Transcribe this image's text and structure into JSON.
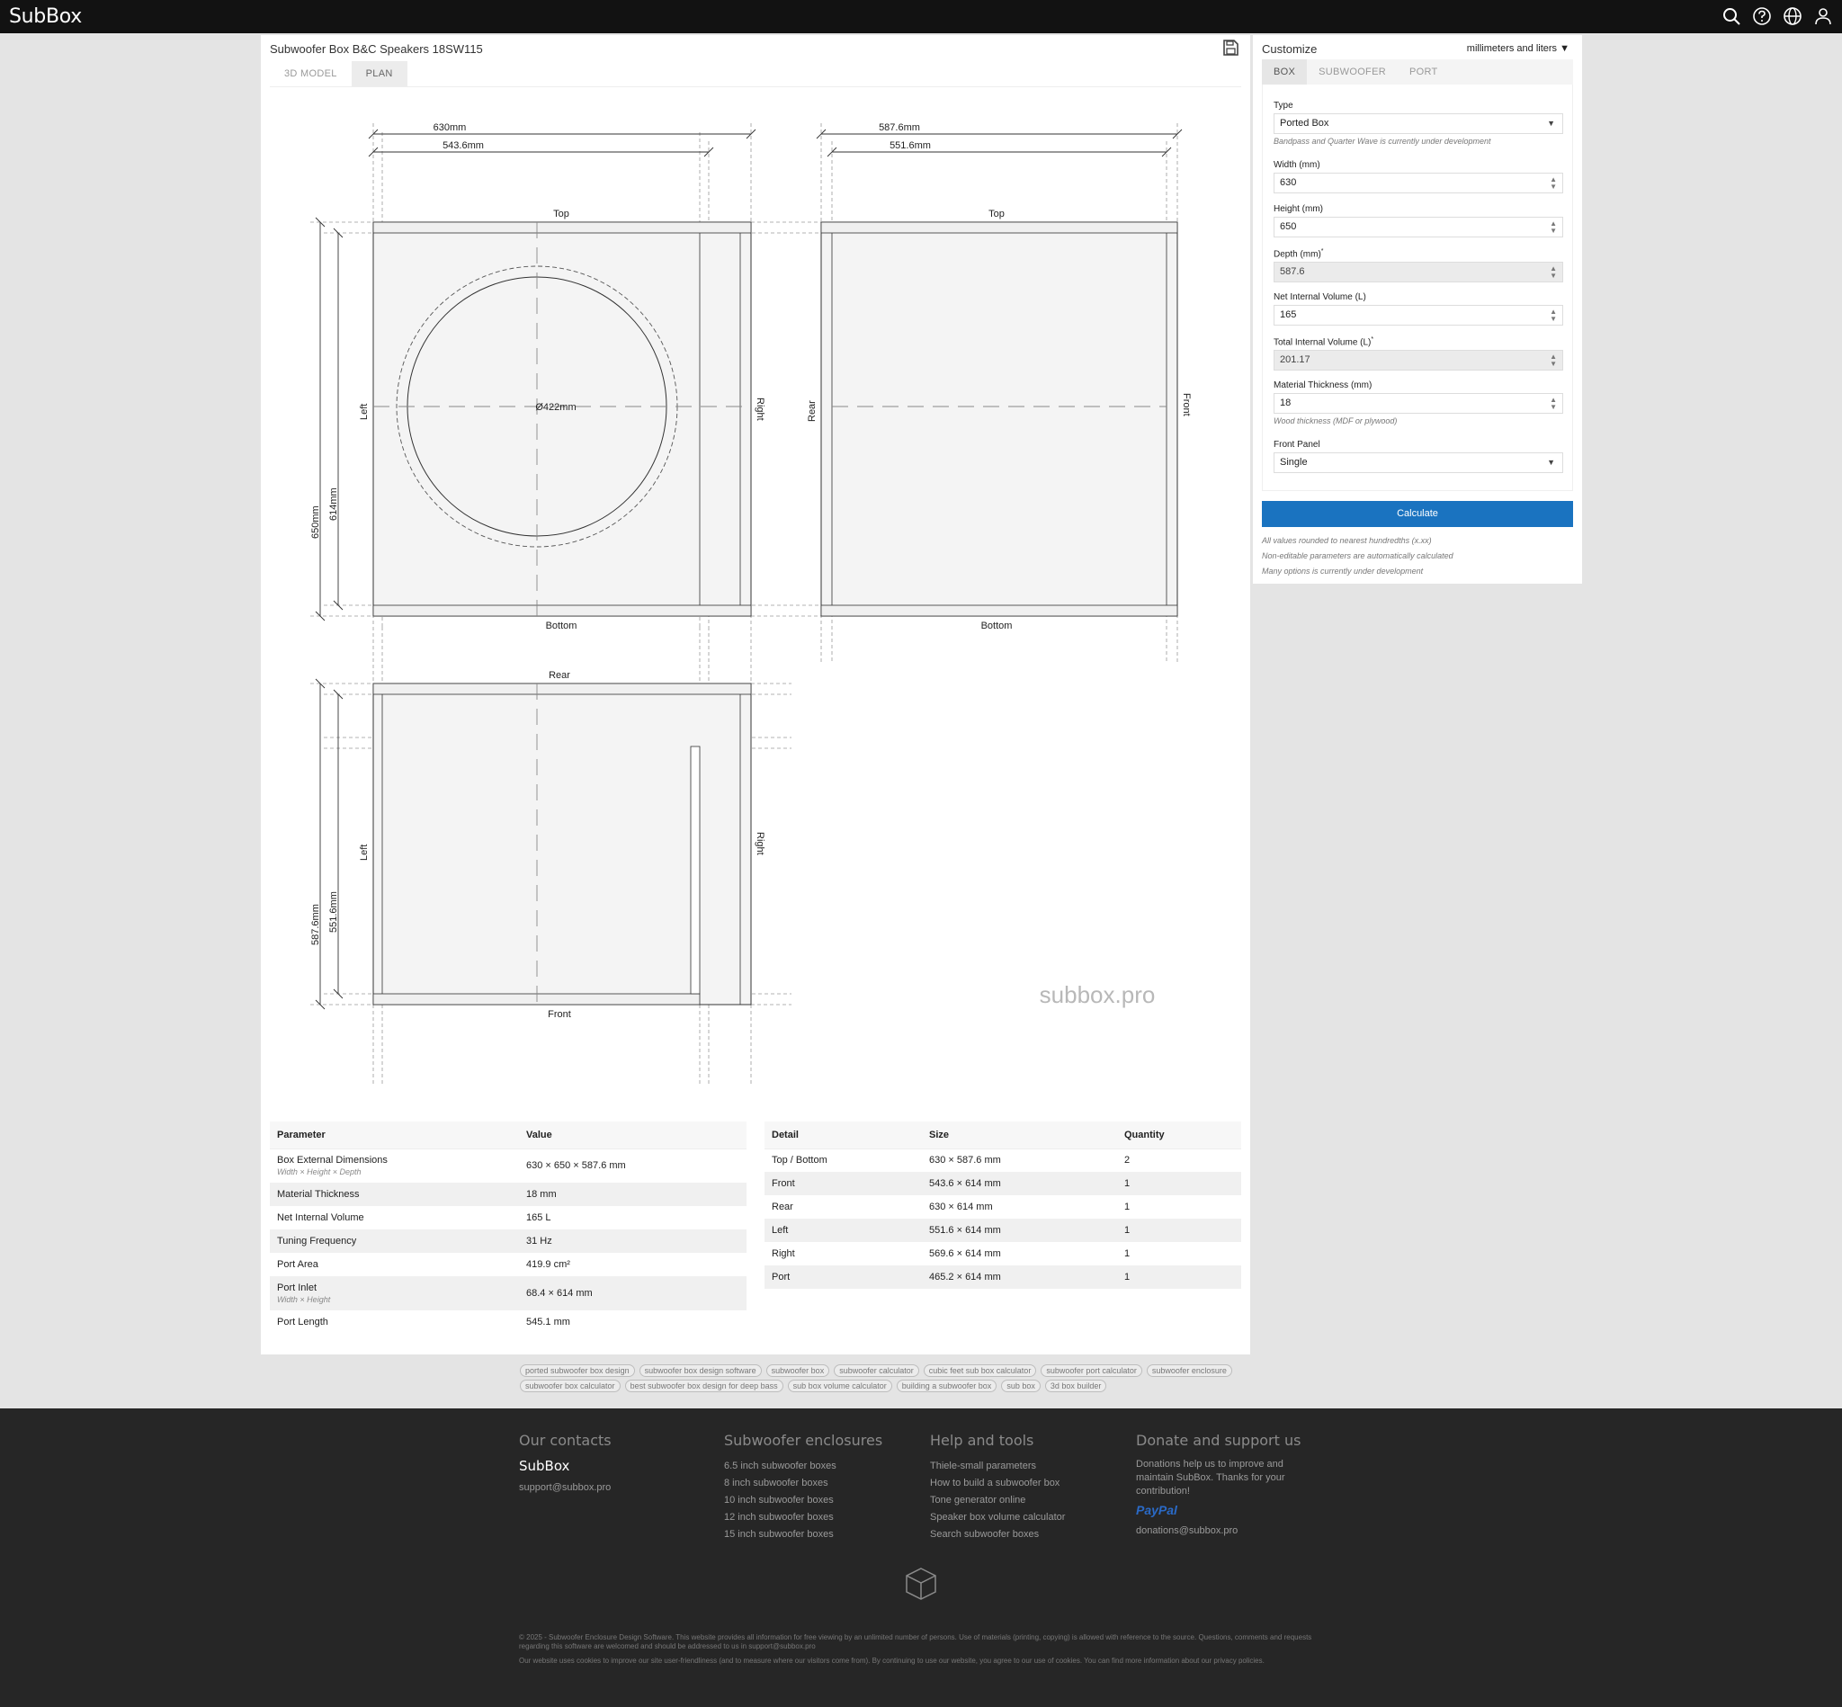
{
  "app": {
    "logo": "SubBox"
  },
  "topbar_icons": [
    "search-icon",
    "help-icon",
    "globe-icon",
    "user-icon"
  ],
  "main": {
    "title": "Subwoofer Box B&C Speakers 18SW115",
    "tabs": [
      {
        "label": "3D MODEL"
      },
      {
        "label": "PLAN"
      }
    ],
    "active_tab": "PLAN"
  },
  "plan": {
    "front_view": {
      "width_dim": "630mm",
      "inner_width_dim": "543.6mm",
      "height_dim": "650mm",
      "inner_height_dim": "614mm",
      "label_top": "Top",
      "label_bottom": "Bottom",
      "label_left": "Left",
      "label_right": "Right",
      "cutout_dim": "Ø422mm"
    },
    "side_view": {
      "depth_dim": "587.6mm",
      "inner_depth_dim": "551.6mm",
      "label_top": "Top",
      "label_bottom": "Bottom",
      "label_rear": "Rear",
      "label_front": "Front"
    },
    "top_view": {
      "depth_dim": "587.6mm",
      "inner_depth_dim": "551.6mm",
      "label_rear": "Rear",
      "label_front": "Front",
      "label_left": "Left",
      "label_right": "Right"
    },
    "watermark": "subbox.pro"
  },
  "param_table": {
    "headers": [
      "Parameter",
      "Value"
    ],
    "rows": [
      {
        "name": "Box External Dimensions",
        "sub": "Width × Height × Depth",
        "value": "630 × 650 × 587.6 mm"
      },
      {
        "name": "Material Thickness",
        "sub": "",
        "value": "18 mm"
      },
      {
        "name": "Net Internal Volume",
        "sub": "",
        "value": "165 L"
      },
      {
        "name": "Tuning Frequency",
        "sub": "",
        "value": "31 Hz"
      },
      {
        "name": "Port Area",
        "sub": "",
        "value": "419.9 cm²"
      },
      {
        "name": "Port Inlet",
        "sub": "Width × Height",
        "value": "68.4 × 614 mm"
      },
      {
        "name": "Port Length",
        "sub": "",
        "value": "545.1 mm"
      }
    ]
  },
  "detail_table": {
    "headers": [
      "Detail",
      "Size",
      "Quantity"
    ],
    "rows": [
      {
        "detail": "Top / Bottom",
        "size": "630 × 587.6 mm",
        "qty": "2"
      },
      {
        "detail": "Front",
        "size": "543.6 × 614 mm",
        "qty": "1"
      },
      {
        "detail": "Rear",
        "size": "630 × 614 mm",
        "qty": "1"
      },
      {
        "detail": "Left",
        "size": "551.6 × 614 mm",
        "qty": "1"
      },
      {
        "detail": "Right",
        "size": "569.6 × 614 mm",
        "qty": "1"
      },
      {
        "detail": "Port",
        "size": "465.2 × 614 mm",
        "qty": "1"
      }
    ]
  },
  "customize": {
    "title": "Customize",
    "units": "millimeters and liters",
    "tabs": [
      {
        "label": "BOX"
      },
      {
        "label": "SUBWOOFER"
      },
      {
        "label": "PORT"
      }
    ],
    "type": {
      "label": "Type",
      "value": "Ported Box",
      "hint": "Bandpass and Quarter Wave is currently under development"
    },
    "width": {
      "label": "Width (mm)",
      "value": "630"
    },
    "height": {
      "label": "Height (mm)",
      "value": "650"
    },
    "depth": {
      "label": "Depth (mm)",
      "value": "587.6"
    },
    "net_volume": {
      "label": "Net Internal Volume (L)",
      "value": "165"
    },
    "total_volume": {
      "label": "Total Internal Volume (L)",
      "value": "201.17"
    },
    "thickness": {
      "label": "Material Thickness (mm)",
      "value": "18",
      "hint": "Wood thickness (MDF or plywood)"
    },
    "front_panel": {
      "label": "Front Panel",
      "value": "Single"
    },
    "calculate_label": "Calculate",
    "notes": [
      "All values rounded to nearest hundredths (x.xx)",
      "Non-editable parameters are automatically calculated",
      "Many options is currently under development"
    ]
  },
  "tags": [
    "ported subwoofer box design",
    "subwoofer box design software",
    "subwoofer box",
    "subwoofer calculator",
    "cubic feet sub box calculator",
    "subwoofer port calculator",
    "subwoofer enclosure",
    "subwoofer box calculator",
    "best subwoofer box design for deep bass",
    "sub box volume calculator",
    "building a subwoofer box",
    "sub box",
    "3d box builder"
  ],
  "footer": {
    "contacts": {
      "title": "Our contacts",
      "brand": "SubBox",
      "email": "support@subbox.pro"
    },
    "enclosures": {
      "title": "Subwoofer enclosures",
      "links": [
        "6.5 inch subwoofer boxes",
        "8 inch subwoofer boxes",
        "10 inch subwoofer boxes",
        "12 inch subwoofer boxes",
        "15 inch subwoofer boxes"
      ]
    },
    "help": {
      "title": "Help and tools",
      "links": [
        "Thiele-small parameters",
        "How to build a subwoofer box",
        "Tone generator online",
        "Speaker box volume calculator",
        "Search subwoofer boxes"
      ]
    },
    "donate": {
      "title": "Donate and support us",
      "text": "Donations help us to improve and maintain SubBox. Thanks for your contribution!",
      "paypal": "PayPal",
      "email": "donations@subbox.pro"
    },
    "legal_1": "© 2025 - Subwoofer Enclosure Design Software. This website provides all information for free viewing by an unlimited number of persons. Use of materials (printing, copying) is allowed with reference to the source. Questions, comments and requests regarding this software are welcomed and should be addressed to us in support@subbox.pro",
    "legal_2": "Our website uses cookies to improve our site user-friendliness (and to measure where our visitors come from). By continuing to use our website, you agree to our use of cookies. You can find more information about our privacy policies."
  },
  "colors": {
    "topbar": "#121212",
    "accent": "#1a73c0",
    "footer": "#262626",
    "panel_fill": "#f4f4f4"
  }
}
